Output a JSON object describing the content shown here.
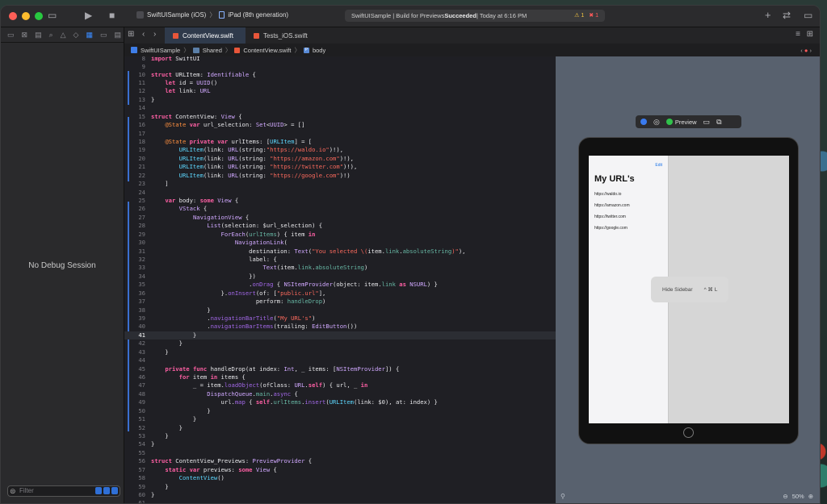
{
  "toolbar": {
    "scheme": "SwiftUISample (iOS)",
    "chevron": "〉",
    "device": "iPad (8th generation)",
    "status_prefix": "SwiftUISample | Build for Previews ",
    "status_bold": "Succeeded",
    "status_suffix": " | Today at 6:16 PM",
    "warnings": "⚠ 1",
    "errors": "✖ 1"
  },
  "navigator": {
    "empty_message": "No Debug Session",
    "filter_placeholder": "Filter"
  },
  "tabs": [
    {
      "label": "ContentView.swift"
    },
    {
      "label": "Tests_iOS.swift"
    }
  ],
  "jump_bar": {
    "project": "SwiftUISample",
    "folder": "Shared",
    "file": "ContentView.swift",
    "symbol": "body",
    "sep": "〉"
  },
  "editor": {
    "current_line": 41
  },
  "preview": {
    "label": "Preview",
    "zoom": "50%",
    "app": {
      "edit": "Edit",
      "title": "My URL's",
      "urls": [
        "https://waldo.io",
        "https://amazon.com",
        "https://twitter.com",
        "https://google.com"
      ],
      "popup_label": "Hide Sidebar",
      "popup_shortcut": "^ ⌘ L"
    }
  },
  "colors": {
    "accent": "#3a6fd0",
    "keyword": "#fc5fa3",
    "string": "#fc6a5d"
  }
}
